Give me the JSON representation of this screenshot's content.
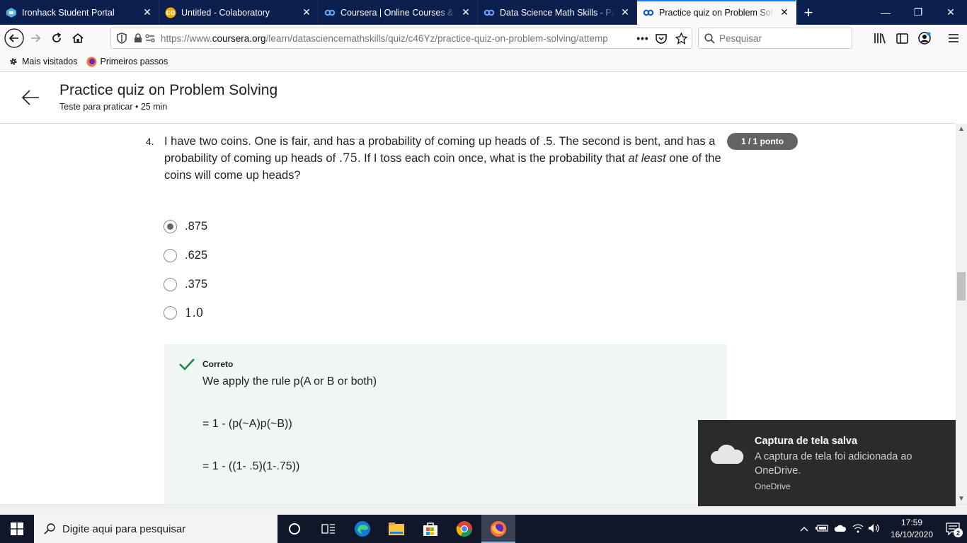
{
  "browser": {
    "tabs": [
      {
        "title": "Ironhack Student Portal",
        "active": false,
        "icon": "ironhack-icon"
      },
      {
        "title": "Untitled - Colaboratory",
        "active": false,
        "icon": "colab-icon"
      },
      {
        "title": "Coursera | Online Courses & Cr",
        "active": false,
        "icon": "coursera-icon"
      },
      {
        "title": "Data Science Math Skills - Págin",
        "active": false,
        "icon": "coursera-icon"
      },
      {
        "title": "Practice quiz on Problem Solvin",
        "active": true,
        "icon": "coursera-icon"
      }
    ],
    "url_prefix": "https://www.",
    "url_domain": "coursera.org",
    "url_path": "/learn/datasciencemathskills/quiz/c46Yz/practice-quiz-on-problem-solving/attemp",
    "search_placeholder": "Pesquisar",
    "bookmarks": [
      "Mais visitados",
      "Primeiros passos"
    ],
    "accent": "#0a84ff"
  },
  "quiz": {
    "title": "Practice quiz on Problem Solving",
    "subtitle": "Teste para praticar • 25 min",
    "question_number": "4.",
    "question_part1": "I have two coins. One is fair, and has a probability of coming up heads of .5. The second is bent, and has a probability of coming up heads of ",
    "question_val": ".75",
    "question_part2": ". If I toss each coin once, what is the probability that ",
    "question_em": "at least",
    "question_part3": " one of the coins will come up heads?",
    "score": "1 / 1 ponto",
    "options": [
      {
        "label": ".875",
        "selected": true
      },
      {
        "label": ".625",
        "selected": false
      },
      {
        "label": ".375",
        "selected": false
      },
      {
        "label": "1.0",
        "selected": false
      }
    ],
    "feedback": {
      "status": "Correto",
      "lines": [
        "We apply the rule p(A or B or both)",
        "= 1 - (p(~A)p(~B))",
        "= 1 - ((1- .5)(1-.75))"
      ],
      "check_color": "#1f8354"
    }
  },
  "toast": {
    "title": "Captura de tela salva",
    "body": "A captura de tela foi adicionada ao OneDrive.",
    "source": "OneDrive"
  },
  "taskbar": {
    "search_placeholder": "Digite aqui para pesquisar",
    "time": "17:59",
    "date": "16/10/2020",
    "notifications": "2"
  }
}
